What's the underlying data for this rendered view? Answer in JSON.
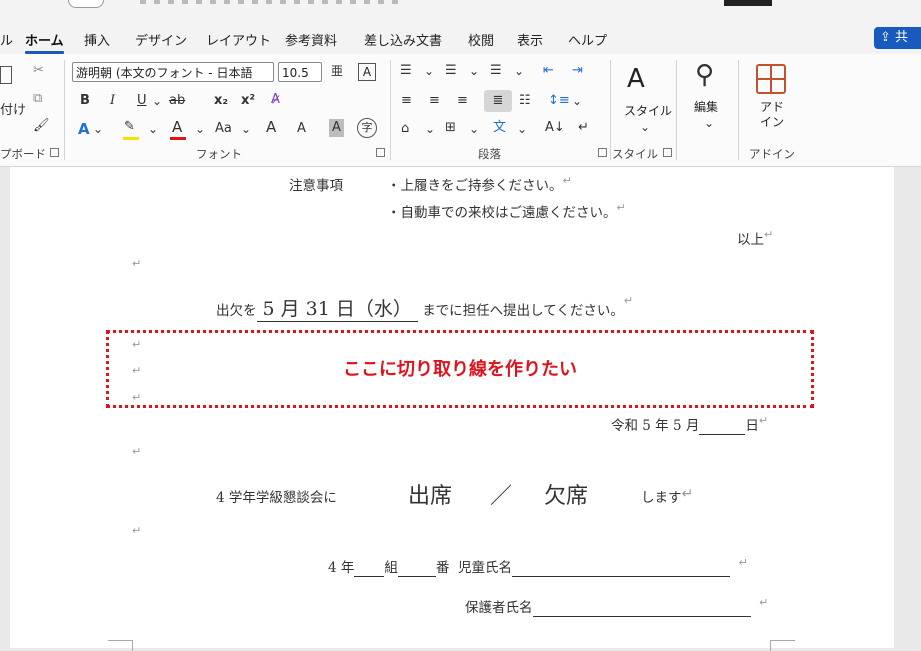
{
  "tabs": [
    {
      "label": "ル"
    },
    {
      "label": "ホーム"
    },
    {
      "label": "挿入"
    },
    {
      "label": "デザイン"
    },
    {
      "label": "レイアウト"
    },
    {
      "label": "参考資料"
    },
    {
      "label": "差し込み文書"
    },
    {
      "label": "校閲"
    },
    {
      "label": "表示"
    },
    {
      "label": "ヘルプ"
    }
  ],
  "share_label": "共",
  "ribbon": {
    "clipboard": {
      "paste_label": "付け",
      "group_label": "プボード"
    },
    "font": {
      "font_name": "游明朝 (本文のフォント - 日本語",
      "font_size": "10.5",
      "bold": "B",
      "italic": "I",
      "underline": "U",
      "strike": "ab",
      "subscript": "x₂",
      "superscript": "x²",
      "font_color": "A",
      "highlight_color": "#f5e400",
      "text_color": "#e0131d",
      "change_case": "Aa",
      "grow": "A",
      "shrink": "A",
      "char_shading": "A",
      "enclose": "字",
      "group_label": "フォント"
    },
    "paragraph": {
      "group_label": "段落"
    },
    "styles": {
      "label": "スタイル",
      "group_label": "スタイル"
    },
    "editing": {
      "label": "編集"
    },
    "addins": {
      "label": "アド\nイン",
      "group_label": "アドイン"
    }
  },
  "document": {
    "note_label": "注意事項",
    "note_line1": "・上履きをご持参ください。",
    "note_line2": "・自動車での来校はご遠慮ください。",
    "closing": "以上",
    "attendance_prefix": "出欠を",
    "deadline": "5 月 31 日（水）",
    "attendance_suffix": "までに担任へ提出してください。",
    "cut_annotation": "ここに切り取り線を作りたい",
    "date_line_prefix": "令和 5 年 5 月",
    "date_line_suffix": "日",
    "meeting_prefix": "4 学年学級懇談会に",
    "attend": "出席",
    "slash": "／",
    "absent": "欠席",
    "meeting_suffix": "します",
    "class_grade": "4 年",
    "class_kumi": "組",
    "class_ban": "番",
    "student_label": "児童氏名",
    "guardian_label": "保護者氏名"
  },
  "marks": {
    "para": "↵",
    "break": "↵"
  }
}
